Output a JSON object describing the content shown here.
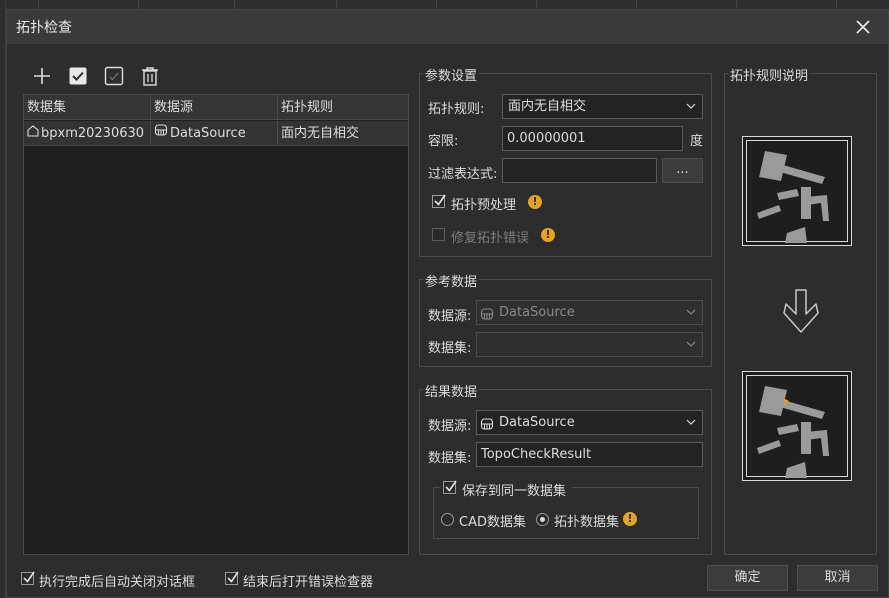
{
  "dialog": {
    "title": "拓扑检查"
  },
  "toolbar": {
    "icons": [
      "plus-icon",
      "select-all-icon",
      "invert-select-icon",
      "delete-icon"
    ]
  },
  "table": {
    "headers": [
      "数据集",
      "数据源",
      "拓扑规则"
    ],
    "rows": [
      {
        "dataset": "bpxm20230630",
        "datasource": "DataSource",
        "rule": "面内无自相交"
      }
    ]
  },
  "params": {
    "legend": "参数设置",
    "rule_label": "拓扑规则:",
    "rule_value": "面内无自相交",
    "tolerance_label": "容限:",
    "tolerance_value": "0.00000001",
    "tolerance_unit": "度",
    "filter_label": "过滤表达式:",
    "filter_value": "",
    "browse_label": "...",
    "preprocess_label": "拓扑预处理",
    "preprocess_checked": true,
    "repair_label": "修复拓扑错误",
    "repair_checked": false
  },
  "reference": {
    "legend": "参考数据",
    "datasource_label": "数据源:",
    "datasource_value": "DataSource",
    "dataset_label": "数据集:",
    "dataset_value": ""
  },
  "result": {
    "legend": "结果数据",
    "datasource_label": "数据源:",
    "datasource_value": "DataSource",
    "dataset_label": "数据集:",
    "dataset_value": "TopoCheckResult",
    "save_same_label": "保存到同一数据集",
    "save_same_checked": true,
    "cad_label": "CAD数据集",
    "topo_label": "拓扑数据集",
    "selected_type": "拓扑数据集"
  },
  "rule_desc": {
    "legend": "拓扑规则说明"
  },
  "footer": {
    "auto_close_label": "执行完成后自动关闭对话框",
    "auto_close_checked": true,
    "open_checker_label": "结束后打开错误检查器",
    "open_checker_checked": true,
    "ok_label": "确定",
    "cancel_label": "取消"
  },
  "colors": {
    "warn": "#e8a31d",
    "background": "#2d2d2d",
    "panel": "#1f1f1f"
  }
}
